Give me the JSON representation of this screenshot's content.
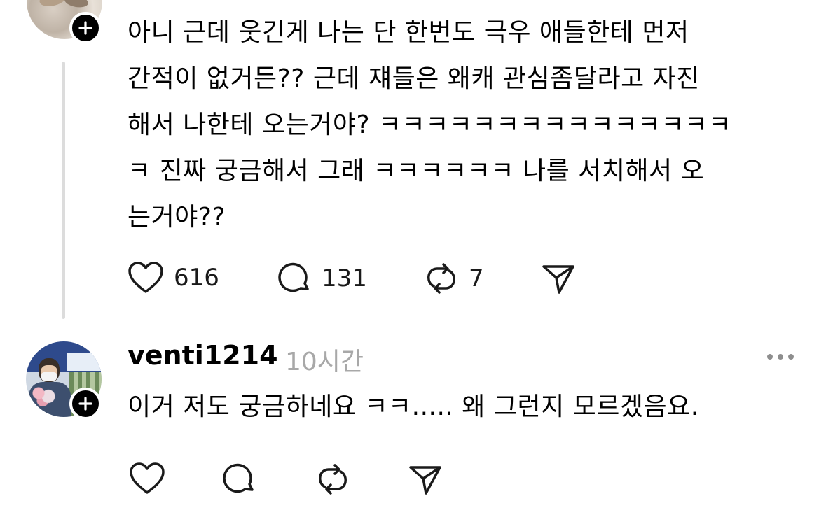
{
  "post": {
    "lines": [
      "아니 근데 웃긴게 나는 단 한번도 극우 애들한테 먼저",
      "간적이 없거든?? 근데 쟤들은 왜캐 관심좀달라고 자진",
      "해서 나한테 오는거야? ㅋㅋㅋㅋㅋㅋㅋㅋㅋㅋㅋㅋㅋㅋㅋ",
      "ㅋ 진짜 궁금해서 그래 ㅋㅋㅋㅋㅋㅋ 나를 서치해서 오",
      "는거야??"
    ],
    "like_count": "616",
    "comment_count": "131",
    "repost_count": "7"
  },
  "reply": {
    "username": "venti1214",
    "time": "10시간",
    "text": "이거 저도 궁금하네요 ㅋㅋ..... 왜 그런지 모르겠음요."
  },
  "icons": {
    "like": "heart-icon",
    "comment": "speech-bubble-icon",
    "repost": "repost-arrows-icon",
    "share": "paper-plane-icon",
    "follow": "plus-icon",
    "more": "more-dots-icon"
  },
  "colors": {
    "text": "#000000",
    "muted": "#a8a8a8",
    "thread_line": "#dcdcdc"
  }
}
